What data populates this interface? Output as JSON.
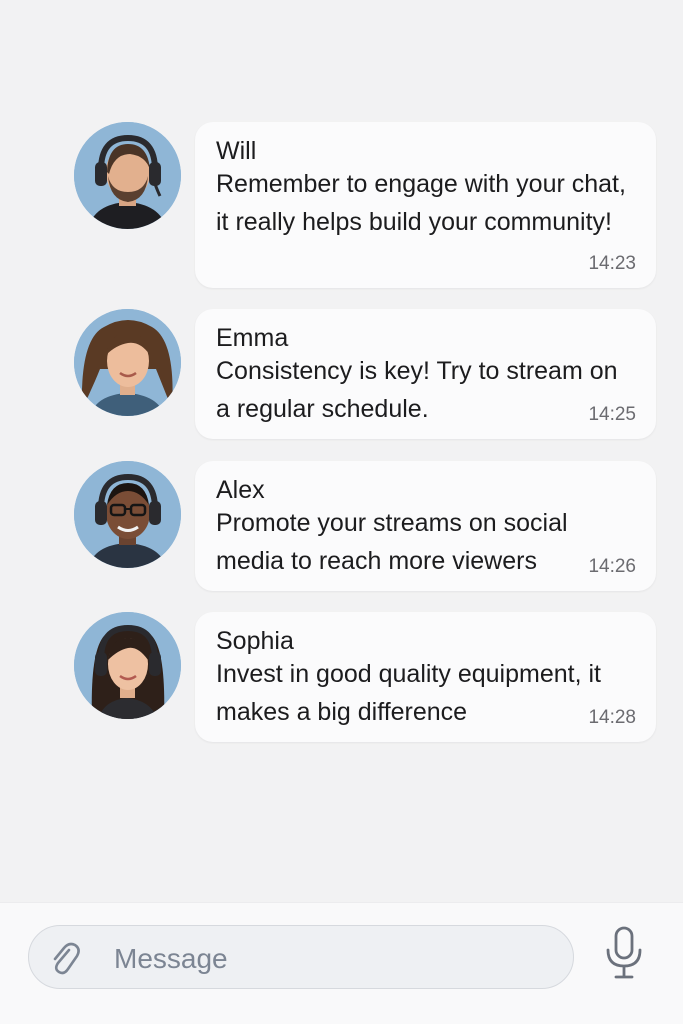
{
  "messages": [
    {
      "sender": "Will",
      "text": "Remember to engage with your chat, it really helps build your community!",
      "time": "14:23",
      "avatar_icon": "person-headset-avatar"
    },
    {
      "sender": "Emma",
      "text": "Consistency is key! Try to stream on a regular schedule.",
      "time": "14:25",
      "avatar_icon": "person-avatar"
    },
    {
      "sender": "Alex",
      "text": "Promote your streams on social media to reach more viewers",
      "time": "14:26",
      "avatar_icon": "person-headset-glasses-avatar"
    },
    {
      "sender": "Sophia",
      "text": "Invest in good quality equipment, it makes a big difference",
      "time": "14:28",
      "avatar_icon": "person-headset-avatar"
    }
  ],
  "composer": {
    "placeholder": "Message",
    "attach_icon": "paperclip-icon",
    "mic_icon": "microphone-icon"
  },
  "colors": {
    "background": "#f2f2f3",
    "bubble": "#fbfbfc",
    "avatar_bg": "#8fb6d6",
    "placeholder": "#7c8593"
  }
}
